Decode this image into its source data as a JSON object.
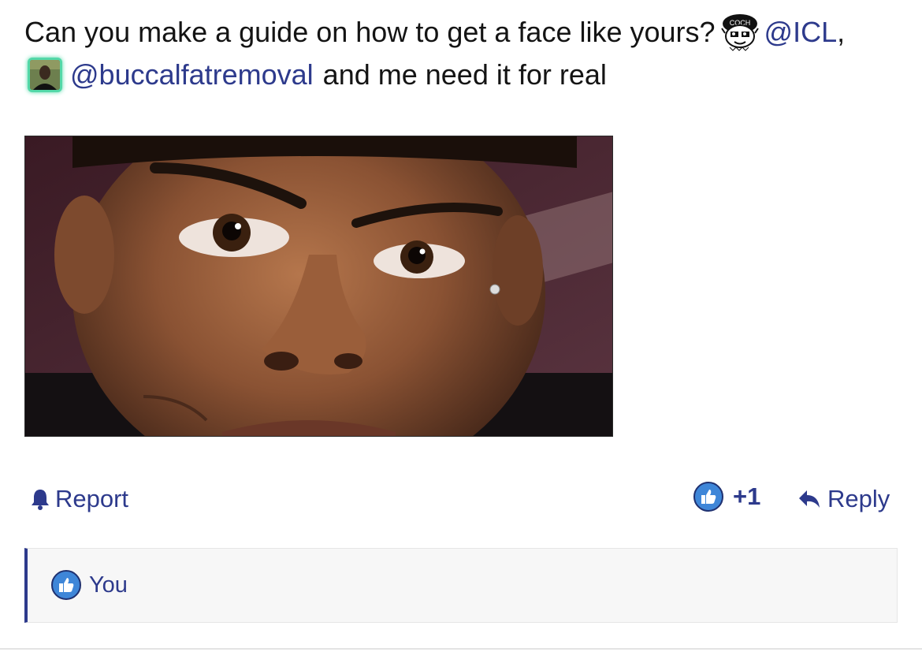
{
  "post": {
    "text_part1": "Can you make a guide on how to get a face like yours?",
    "mention1": "@ICL",
    "comma": ",",
    "mention2": "@buccalfatremoval",
    "text_part2": "and me need it for real",
    "avatar1_label": "COCH",
    "avatar1_icon": "cartoon-face-avatar",
    "avatar2_icon": "user-photo-avatar"
  },
  "actions": {
    "report_label": "Report",
    "report_icon": "bell-icon",
    "like_count": "+1",
    "like_icon": "thumbs-up-icon",
    "reply_label": "Reply",
    "reply_icon": "reply-arrow-icon"
  },
  "likes": {
    "names": "You",
    "icon": "thumbs-up-icon"
  },
  "colors": {
    "link": "#2d3a8c",
    "like_badge": "#3e86d8",
    "avatar_glow": "#53d8a8",
    "box_bg": "#f7f7f7"
  }
}
